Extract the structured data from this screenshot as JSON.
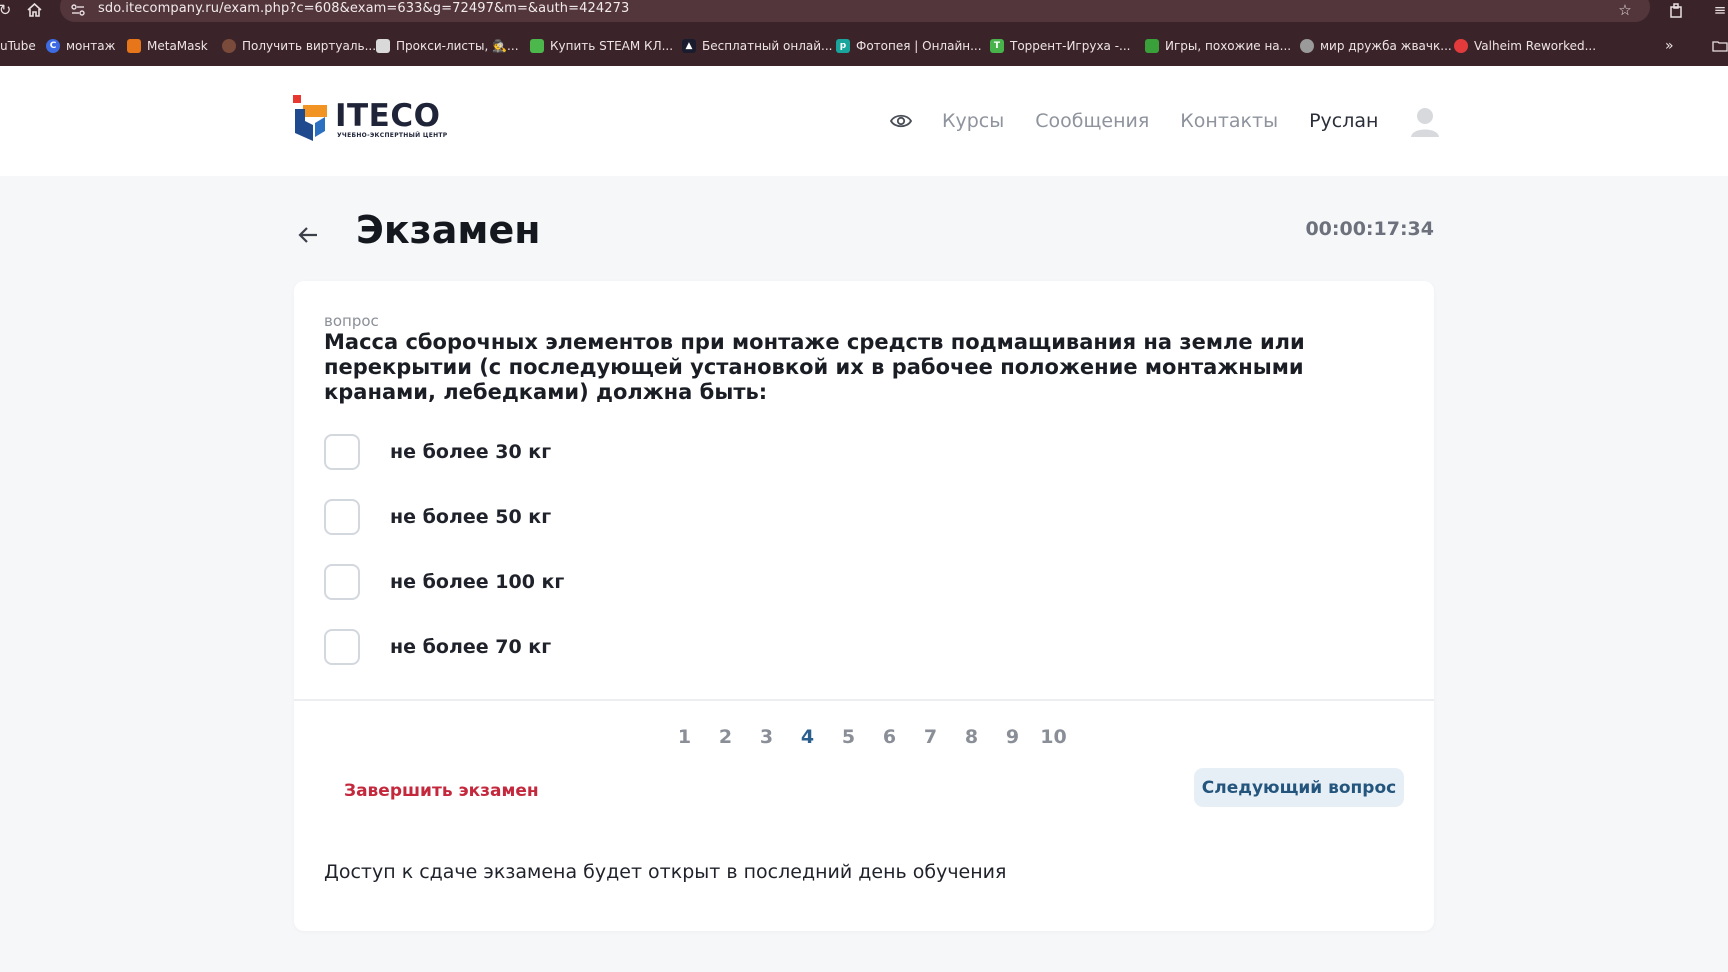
{
  "browser": {
    "url": "sdo.itecompany.ru/exam.php?c=608&exam=633&g=72497&m=&auth=424273",
    "bookmarks": [
      {
        "label": "uTube",
        "color": "#ff3b3b"
      },
      {
        "label": "монтаж",
        "color": "#3d6be3"
      },
      {
        "label": "MetaMask",
        "color": "#e7761b"
      },
      {
        "label": "Получить виртуаль...",
        "color": "#7a4a3a"
      },
      {
        "label": "Прокси-листы, 🕵...",
        "color": "#d9d9d9"
      },
      {
        "label": "Купить STEAM КЛ...",
        "color": "#4cb84c"
      },
      {
        "label": "Бесплатный онлай...",
        "color": "#1b1b2e"
      },
      {
        "label": "Фотопея | Онлайн...",
        "color": "#1aa59c"
      },
      {
        "label": "Торрент-Игруха -...",
        "color": "#49b34b"
      },
      {
        "label": "Игры, похожие на...",
        "color": "#3aa03a"
      },
      {
        "label": "мир дружба жвачк...",
        "color": "#9a9a9a"
      },
      {
        "label": "Valheim Reworked...",
        "color": "#e33b3b"
      }
    ]
  },
  "header": {
    "logo_text": "ITECO",
    "logo_subtext": "УЧЕБНО-ЭКСПЕРТНЫЙ ЦЕНТР",
    "nav": [
      "Курсы",
      "Сообщения",
      "Контакты"
    ],
    "user_name": "Руслан"
  },
  "exam": {
    "title": "Экзамен",
    "timer": "00:00:17:34",
    "question_label": "вопрос",
    "question_text": "Масса сборочных элементов при монтаже средств подмащивания на земле или перекрытии (с последующей установкой их в рабочее положение монтажными кранами, лебедками) должна быть:",
    "options": [
      "не более 30 кг",
      "не более 50 кг",
      "не более 100 кг",
      "не более 70 кг"
    ],
    "pages": [
      "1",
      "2",
      "3",
      "4",
      "5",
      "6",
      "7",
      "8",
      "9",
      "10"
    ],
    "current_page": "4",
    "finish_label": "Завершить экзамен",
    "next_label": "Следующий вопрос",
    "access_note": "Доступ к сдаче экзамена будет открыт в последний день обучения"
  },
  "colors": {
    "accent_blue": "#2a5f8e",
    "danger_red": "#c4283c",
    "chrome_bg": "#3a2429"
  }
}
